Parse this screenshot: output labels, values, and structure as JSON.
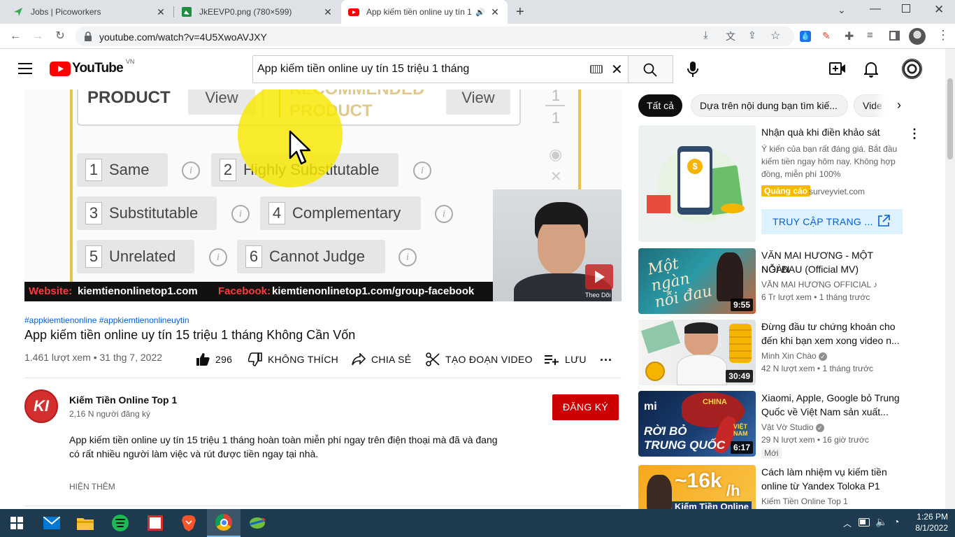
{
  "browser": {
    "tabs": [
      {
        "title": "Jobs | Picoworkers"
      },
      {
        "title": "JkEEVP0.png (780×599)"
      },
      {
        "title": "App kiếm tiền online uy tín 1"
      }
    ],
    "url": "youtube.com/watch?v=4U5XwoAVJXY"
  },
  "youtube": {
    "logo_text": "YouTube",
    "region": "VN",
    "search_value": "App kiếm tiền online uy tín 15 triệu 1 tháng"
  },
  "video_frame": {
    "product_label": "PRODUCT",
    "recommended_label": "RECOMMENDED",
    "recommended_product": "PRODUCT",
    "view1": "View",
    "view2": "View",
    "counter_top": "1",
    "counter_bottom": "1",
    "options": [
      {
        "n": "1",
        "label": "Same"
      },
      {
        "n": "2",
        "label": "Highly Substitutable"
      },
      {
        "n": "3",
        "label": "Substitutable"
      },
      {
        "n": "4",
        "label": "Complementary"
      },
      {
        "n": "5",
        "label": "Unrelated"
      },
      {
        "n": "6",
        "label": "Cannot Judge"
      }
    ],
    "website_label": "Website:",
    "website": "kiemtienonlinetop1.com",
    "facebook_label": "Facebook:",
    "facebook": "kiemtienonlinetop1.com/group-facebook",
    "subscribe_overlay": "Theo Dõi"
  },
  "video": {
    "hashtags": "#appkiemtienonline #appkiemtienonlineuytin",
    "title": "App kiếm tiền online uy tín 15 triệu 1 tháng Không Cần Vốn",
    "meta": "1.461 lượt xem • 31 thg 7, 2022",
    "likes": "296",
    "dislike": "KHÔNG THÍCH",
    "share": "CHIA SẺ",
    "clip": "TẠO ĐOẠN VIDEO",
    "save": "LƯU",
    "more": "..."
  },
  "channel": {
    "avatar_text": "KI",
    "name": "Kiếm Tiền Online Top 1",
    "subs": "2,16 N người đăng ký",
    "subscribe": "ĐĂNG KÝ",
    "description_line1": "App kiếm tiền online uy tín 15 triệu 1 tháng hoàn toàn miễn phí ngay trên điện thoại mà đã và đang",
    "description_line2": "có rất nhiều người làm việc và rút được tiền ngay tại nhà.",
    "show_more": "HIỆN THÊM"
  },
  "chips": [
    "Tất cả",
    "Dựa trên nội dung bạn tìm kiế...",
    "Vide"
  ],
  "ad": {
    "title": "Nhận quà khi điền khảo sát",
    "body_line1": "Ý kiến của bạn rất đáng giá. Bắt đầu",
    "body_line2": "kiếm tiền ngay hôm nay. Không hợp",
    "body_line3": "đồng, miễn phí 100%",
    "badge": "Quảng cáo",
    "domain": "surveyviet.com",
    "cta": "TRUY CẬP TRANG ..."
  },
  "recommendations": [
    {
      "title1": "VĂN MAI HƯƠNG - MỘT NGÀN",
      "title2": "NỖI ĐAU (Official MV)",
      "channel": "VĂN MAI HƯƠNG OFFICIAL ♪",
      "meta": "6 Tr lượt xem • 1 tháng trước",
      "duration": "9:55",
      "thumb_text": "Một ngàn nỗi đau"
    },
    {
      "title1": "Đừng đầu tư chứng khoán cho",
      "title2": "đến khi bạn xem xong video n...",
      "channel": "Minh Xin Chào",
      "meta": "42 N lượt xem • 1 tháng trước",
      "duration": "30:49"
    },
    {
      "title1": "Xiaomi, Apple, Google bỏ Trung",
      "title2": "Quốc về Việt Nam sản xuất...",
      "channel": "Vật Vờ Studio",
      "meta": "29 N lượt xem • 16 giờ trước",
      "badge": "Mới",
      "duration": "6:17",
      "thumb_line1": "RỜI BỎ",
      "thumb_line2": "TRUNG QUỐC",
      "thumb_china": "CHINA",
      "thumb_vn1": "VIỆT",
      "thumb_vn2": "NAM"
    },
    {
      "title1": "Cách làm nhiệm vụ kiếm tiền",
      "title2": "online từ Yandex Toloka P1",
      "channel": "Kiếm Tiền Online Top 1",
      "thumb_big": "~16k",
      "thumb_unit": "/h",
      "thumb_bottom": "Kiếm Tiền Online"
    }
  ],
  "taskbar": {
    "time": "1:26 PM",
    "date": "8/1/2022"
  },
  "colors": {
    "yt_red": "#ff0000",
    "subscribe_red": "#cc0000",
    "link_blue": "#065fd4",
    "ad_yellow": "#f9b900",
    "taskbar": "#1d3a4f"
  }
}
